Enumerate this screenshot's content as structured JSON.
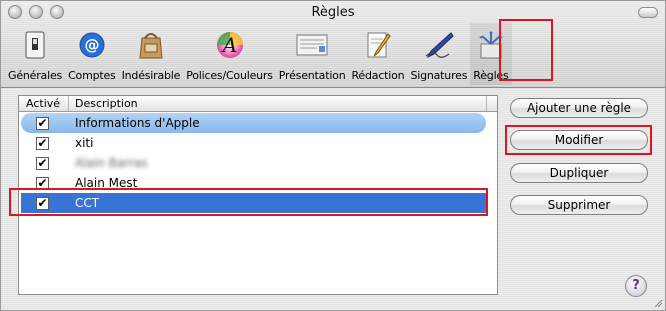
{
  "window": {
    "title": "Règles"
  },
  "toolbar": {
    "items": [
      {
        "label": "Générales",
        "icon": "switch-icon"
      },
      {
        "label": "Comptes",
        "icon": "at-icon"
      },
      {
        "label": "Indésirable",
        "icon": "junk-bag-icon"
      },
      {
        "label": "Polices/Couleurs",
        "icon": "font-color-icon"
      },
      {
        "label": "Présentation",
        "icon": "presentation-icon"
      },
      {
        "label": "Rédaction",
        "icon": "pencil-icon"
      },
      {
        "label": "Signatures",
        "icon": "pen-icon"
      },
      {
        "label": "Règles",
        "icon": "rules-icon"
      }
    ],
    "selected": "Règles"
  },
  "rules_table": {
    "headers": {
      "active": "Activé",
      "description": "Description"
    },
    "rows": [
      {
        "active": true,
        "description": "Informations d'Apple"
      },
      {
        "active": true,
        "description": "xiti"
      },
      {
        "active": true,
        "description": "Alain Barras"
      },
      {
        "active": true,
        "description": "Alain Mest"
      },
      {
        "active": true,
        "description": "CCT"
      }
    ],
    "highlighted_row": "Informations d'Apple",
    "selected_row": "CCT"
  },
  "actions": {
    "add": "Ajouter une règle",
    "edit": "Modifier",
    "duplicate": "Dupliquer",
    "delete": "Supprimer",
    "help": "?"
  },
  "colors": {
    "selection": "#3873d6",
    "annotation": "#e0141c",
    "highlight": "#9dc4f1"
  }
}
